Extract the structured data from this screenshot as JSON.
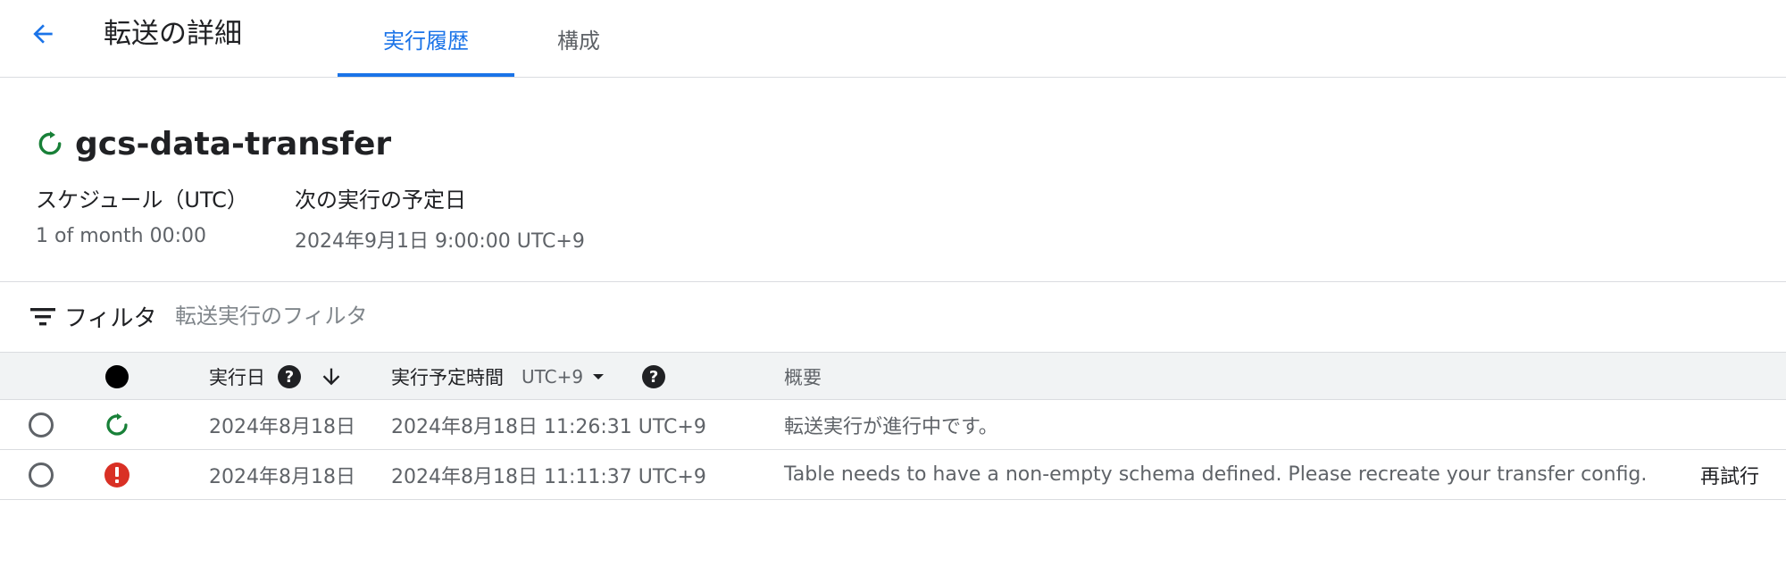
{
  "header": {
    "title": "転送の詳細",
    "tabs": [
      {
        "label": "実行履歴",
        "active": true
      },
      {
        "label": "構成",
        "active": false
      }
    ]
  },
  "transfer": {
    "name": "gcs-data-transfer",
    "status_icon": "running-refresh-icon",
    "schedule_label": "スケジュール（UTC）",
    "schedule_value": "1 of month 00:00",
    "next_run_label": "次の実行の予定日",
    "next_run_value": "2024年9月1日 9:00:00 UTC+9"
  },
  "filter": {
    "label": "フィルタ",
    "placeholder": "転送実行のフィルタ"
  },
  "table": {
    "headers": {
      "run_date": "実行日",
      "scheduled_time": "実行予定時間",
      "timezone": "UTC+9",
      "summary": "概要"
    },
    "rows": [
      {
        "status": "running",
        "run_date": "2024年8月18日",
        "scheduled_time": "2024年8月18日 11:26:31 UTC+9",
        "summary": "転送実行が進行中です。",
        "action": ""
      },
      {
        "status": "error",
        "run_date": "2024年8月18日",
        "scheduled_time": "2024年8月18日 11:11:37 UTC+9",
        "summary": "Table needs to have a non-empty schema defined. Please recreate your transfer config.",
        "action": "再試行"
      }
    ]
  },
  "colors": {
    "accent": "#1a73e8",
    "success": "#188038",
    "error": "#d93025",
    "header_bg": "#f1f3f4"
  }
}
